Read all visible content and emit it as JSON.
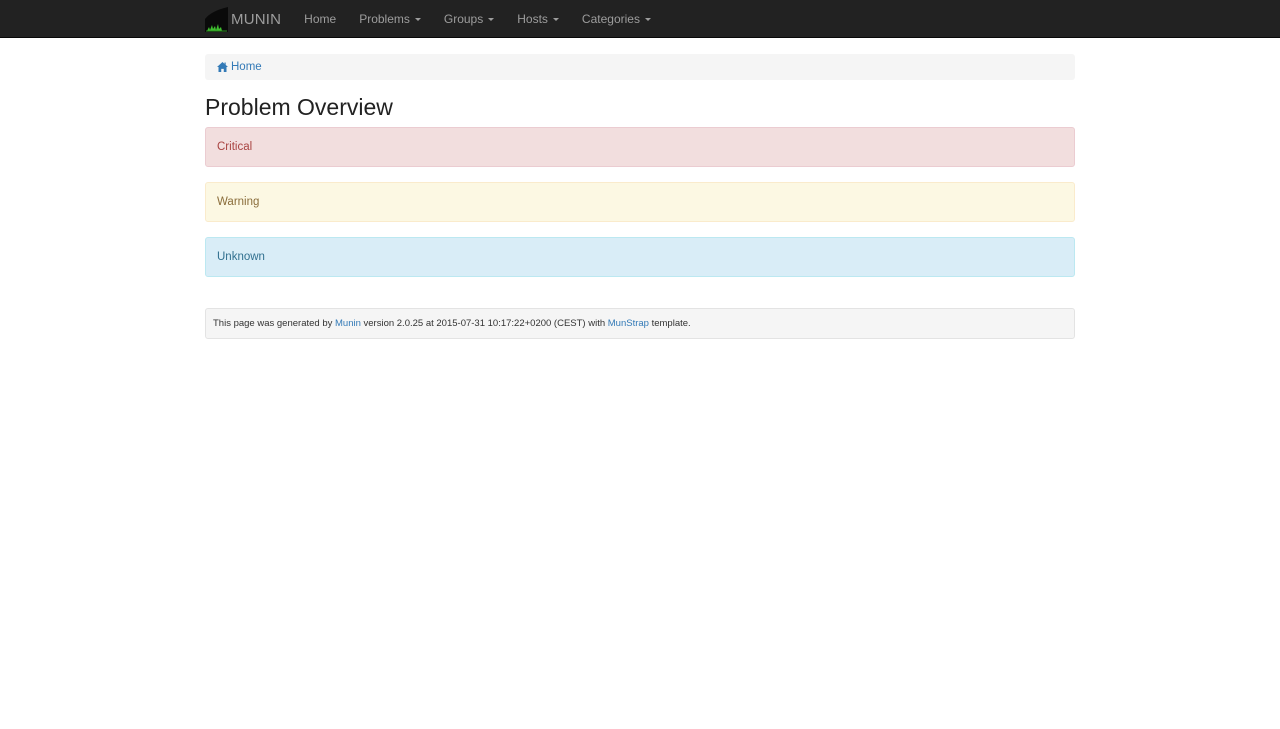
{
  "navbar": {
    "brand": "MUNIN",
    "items": [
      {
        "label": "Home",
        "dropdown": false
      },
      {
        "label": "Problems",
        "dropdown": true
      },
      {
        "label": "Groups",
        "dropdown": true
      },
      {
        "label": "Hosts",
        "dropdown": true
      },
      {
        "label": "Categories",
        "dropdown": true
      }
    ]
  },
  "breadcrumb": {
    "home_label": "Home",
    "icon": "home-icon"
  },
  "page": {
    "title": "Problem Overview"
  },
  "alerts": {
    "critical": "Critical",
    "warning": "Warning",
    "unknown": "Unknown"
  },
  "footer": {
    "prefix": "This page was generated by ",
    "munin_link": "Munin",
    "middle": " version 2.0.25 at 2015-07-31 10:17:22+0200 (CEST) with ",
    "template_link": "MunStrap",
    "suffix": " template."
  },
  "colors": {
    "navbar_bg": "#222222",
    "link": "#337ab7",
    "critical_bg": "#f2dede",
    "warning_bg": "#fcf8e3",
    "unknown_bg": "#d9edf7"
  }
}
